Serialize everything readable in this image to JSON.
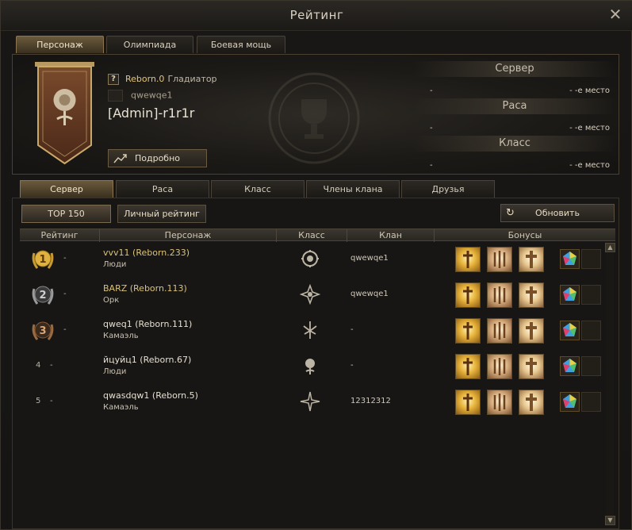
{
  "window": {
    "title": "Рейтинг"
  },
  "top_tabs": [
    {
      "label": "Персонаж",
      "active": true
    },
    {
      "label": "Олимпиада",
      "active": false
    },
    {
      "label": "Боевая мощь",
      "active": false
    }
  ],
  "profile": {
    "reborn_tag": "Reborn.0",
    "class_name": "Гладиатор",
    "clan_name": "qwewqe1",
    "character_name": "[Admin]-r1r1r",
    "detail_button": "Подробно",
    "help_icon_text": "?"
  },
  "rankings": [
    {
      "header": "Сервер",
      "left": "-",
      "right": "- -е место"
    },
    {
      "header": "Раса",
      "left": "-",
      "right": "- -е место"
    },
    {
      "header": "Класс",
      "left": "-",
      "right": "- -е место"
    }
  ],
  "sub_tabs": [
    {
      "label": "Сервер",
      "active": true
    },
    {
      "label": "Раса",
      "active": false
    },
    {
      "label": "Класс",
      "active": false
    },
    {
      "label": "Члены клана",
      "active": false
    },
    {
      "label": "Друзья",
      "active": false
    }
  ],
  "filters": {
    "top150": "TOP 150",
    "personal": "Личный рейтинг",
    "refresh": "Обновить"
  },
  "table": {
    "headers": [
      "Рейтинг",
      "Персонаж",
      "Класс",
      "Клан",
      "Бонусы"
    ],
    "rows": [
      {
        "rank": "1",
        "dash": "-",
        "name": "vvv11 (Reborn.233)",
        "race": "Люди",
        "clan": "qwewqe1"
      },
      {
        "rank": "2",
        "dash": "-",
        "name": "BARZ (Reborn.113)",
        "race": "Орк",
        "clan": "qwewqe1"
      },
      {
        "rank": "3",
        "dash": "-",
        "name": "qweq1 (Reborn.111)",
        "race": "Камаэль",
        "clan": "-"
      },
      {
        "rank": "4",
        "dash": "-",
        "name": "йцуйц1 (Reborn.67)",
        "race": "Люди",
        "clan": "-"
      },
      {
        "rank": "5",
        "dash": "-",
        "name": "qwasdqw1 (Reborn.5)",
        "race": "Камаэль",
        "clan": "12312312"
      }
    ]
  },
  "colors": {
    "gold_name": "#d9c27a",
    "active_tab": "#6b5a3c",
    "background": "#171614"
  }
}
